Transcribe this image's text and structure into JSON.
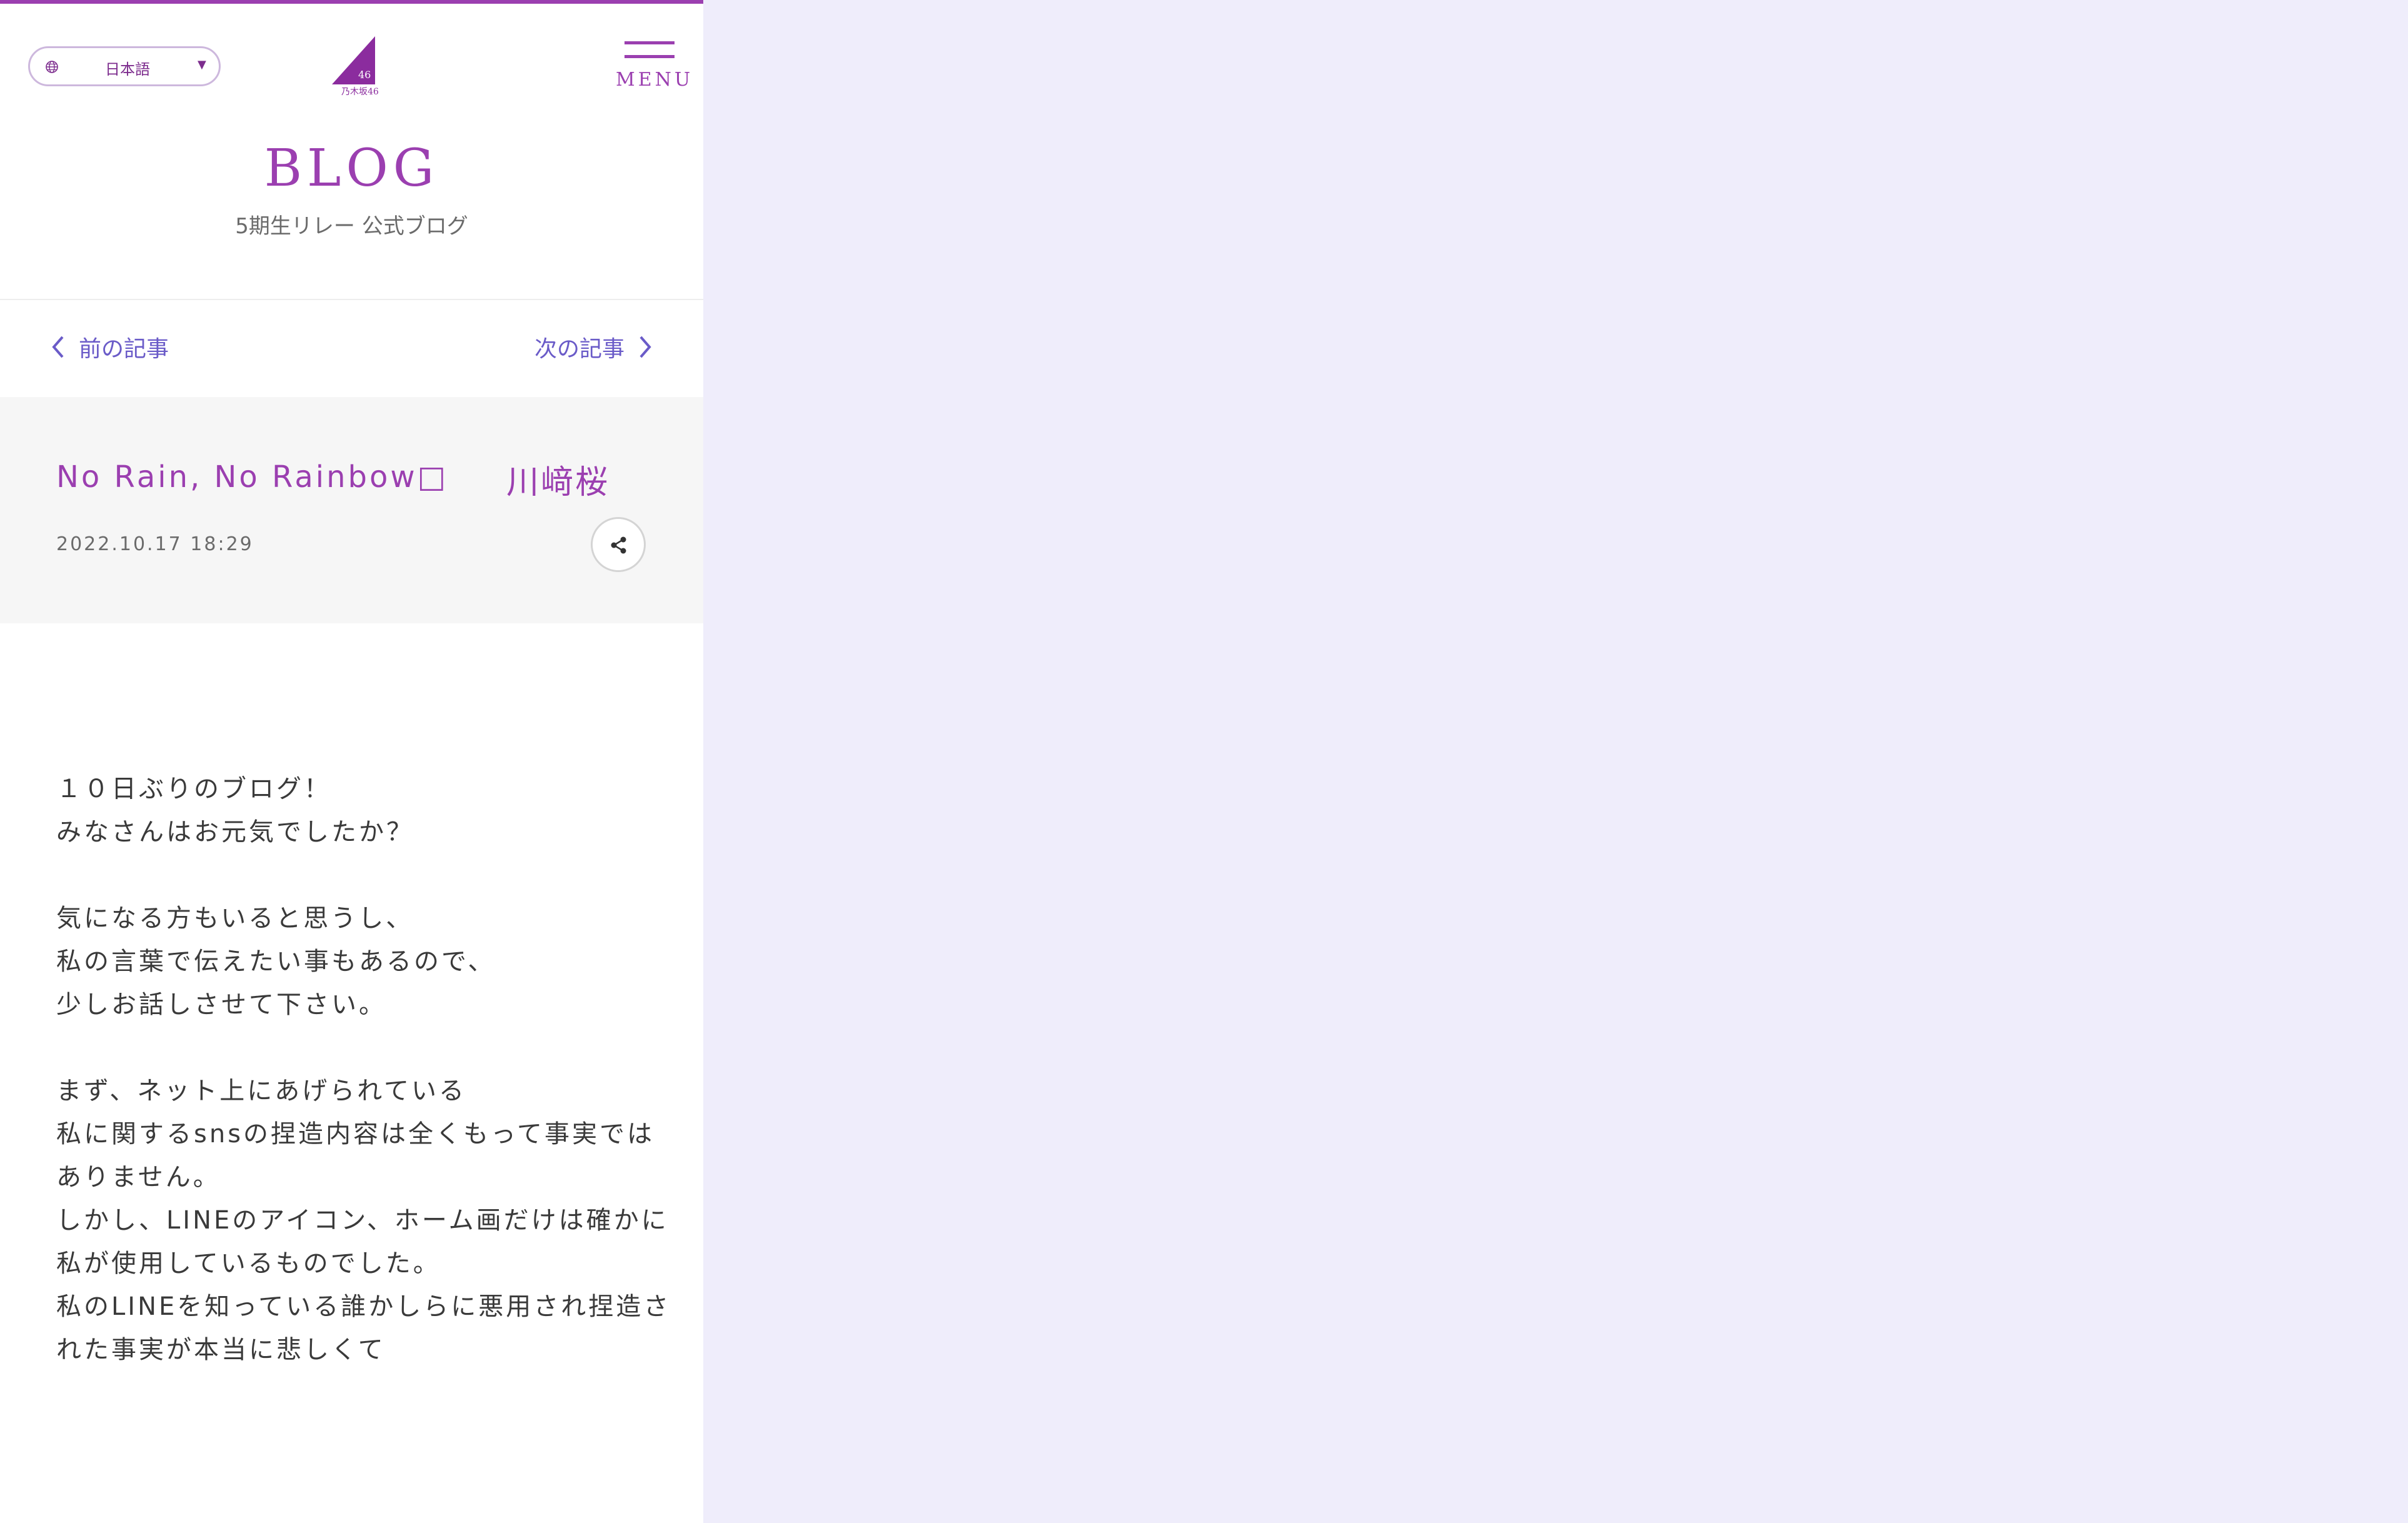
{
  "language_selector": {
    "label": "日本語",
    "caret": "▼"
  },
  "logo": {
    "text": "乃木坂46"
  },
  "menu": {
    "label": "MENU"
  },
  "page": {
    "title": "BLOG",
    "subtitle": "5期生リレー 公式ブログ"
  },
  "pager": {
    "prev_label": "前の記事",
    "next_label": "次の記事"
  },
  "entry": {
    "title": "No Rain, No Rainbow□",
    "author": "川﨑桜",
    "date": "2022.10.17 18:29",
    "body": [
      "１０日ぶりのブログ！",
      "みなさんはお元気でしたか？",
      "",
      "気になる方もいると思うし、",
      "私の言葉で伝えたい事もあるので、",
      "少しお話しさせて下さい。",
      "",
      "まず、ネット上にあげられている",
      "私に関するsnsの捏造内容は全くもって事実では",
      "ありません。",
      "しかし、LINEのアイコン、ホーム画だけは確かに",
      "私が使用しているものでした。",
      "私のLINEを知っている誰かしらに悪用され捏造さ",
      "れた事実が本当に悲しくて"
    ]
  },
  "colors": {
    "accent": "#9b3fb0",
    "link": "#6a5bc8",
    "side_background": "#efedfb"
  }
}
